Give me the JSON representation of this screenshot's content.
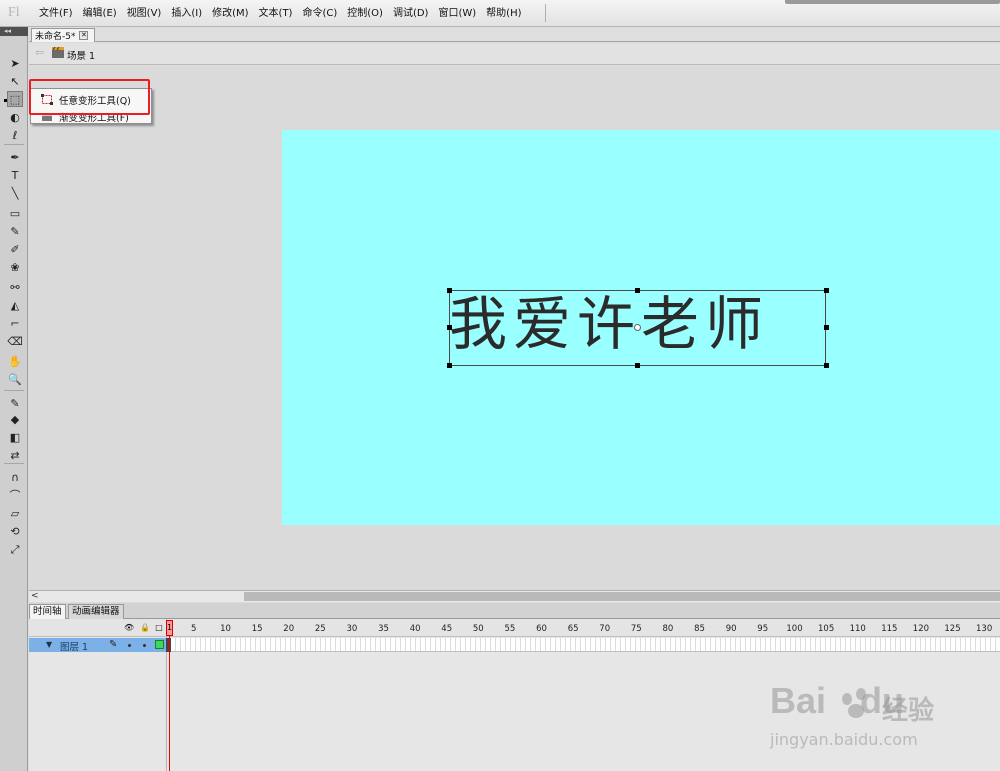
{
  "app": {
    "logo": "Fl",
    "menu": [
      "文件(F)",
      "编辑(E)",
      "视图(V)",
      "插入(I)",
      "修改(M)",
      "文本(T)",
      "命令(C)",
      "控制(O)",
      "调试(D)",
      "窗口(W)",
      "帮助(H)"
    ]
  },
  "document": {
    "tab_title": "未命名-5*",
    "close_glyph": "✕",
    "scene_label": "场景 1"
  },
  "toolbar": {
    "collapse_glyph": "◂◂",
    "tools": [
      {
        "name": "selection-tool-icon",
        "glyph": "➤"
      },
      {
        "name": "subselection-tool-icon",
        "glyph": "↖"
      },
      {
        "name": "free-transform-tool-icon",
        "glyph": "⬚"
      },
      {
        "name": "3d-rotation-tool-icon",
        "glyph": "◐"
      },
      {
        "name": "lasso-tool-icon",
        "glyph": "ℓ"
      },
      {
        "name": "pen-tool-icon",
        "glyph": "✒"
      },
      {
        "name": "text-tool-icon",
        "glyph": "T"
      },
      {
        "name": "line-tool-icon",
        "glyph": "╲"
      },
      {
        "name": "rectangle-tool-icon",
        "glyph": "▭"
      },
      {
        "name": "pencil-tool-icon",
        "glyph": "✎"
      },
      {
        "name": "brush-tool-icon",
        "glyph": "✐"
      },
      {
        "name": "deco-tool-icon",
        "glyph": "❀"
      },
      {
        "name": "bone-tool-icon",
        "glyph": "⚯"
      },
      {
        "name": "paint-bucket-tool-icon",
        "glyph": "◭"
      },
      {
        "name": "eyedropper-tool-icon",
        "glyph": "⌐"
      },
      {
        "name": "eraser-tool-icon",
        "glyph": "⌫"
      },
      {
        "name": "hand-tool-icon",
        "glyph": "✋"
      },
      {
        "name": "zoom-tool-icon",
        "glyph": "🔍"
      },
      {
        "name": "stroke-color-icon",
        "glyph": "✎"
      },
      {
        "name": "fill-color-icon",
        "glyph": "◆"
      },
      {
        "name": "black-white-icon",
        "glyph": "◧"
      },
      {
        "name": "swap-colors-icon",
        "glyph": "⇄"
      },
      {
        "name": "snap-magnet-icon",
        "glyph": "∩"
      },
      {
        "name": "smooth-option-icon",
        "glyph": "⌒"
      },
      {
        "name": "straighten-option-icon",
        "glyph": "▱"
      },
      {
        "name": "rotate-skew-option-icon",
        "glyph": "⟲"
      },
      {
        "name": "scale-option-icon",
        "glyph": "⤢"
      }
    ]
  },
  "popup": {
    "items": [
      "任意变形工具(Q)",
      "渐变变形工具(F)"
    ]
  },
  "stage": {
    "text": "我爱许老师",
    "background_color": "#99ffff"
  },
  "scrollbar": {
    "left_arrow": "<"
  },
  "timeline": {
    "tabs": [
      "时间轴",
      "动画编辑器"
    ],
    "header_icons": [
      "👁",
      "🔒",
      "□"
    ],
    "layer_name": "图层 1",
    "layer_pencil": "✎",
    "layer_icon": "▼",
    "current_frame": "1",
    "ruler": [
      "5",
      "10",
      "15",
      "20",
      "25",
      "30",
      "35",
      "40",
      "45",
      "50",
      "55",
      "60",
      "65",
      "70",
      "75",
      "80",
      "85",
      "90",
      "95",
      "100",
      "105",
      "110",
      "115",
      "120",
      "125",
      "130"
    ]
  },
  "watermark": {
    "brand": "Bai",
    "brand_suffix": "du",
    "cn": "经验",
    "url": "jingyan.baidu.com"
  }
}
